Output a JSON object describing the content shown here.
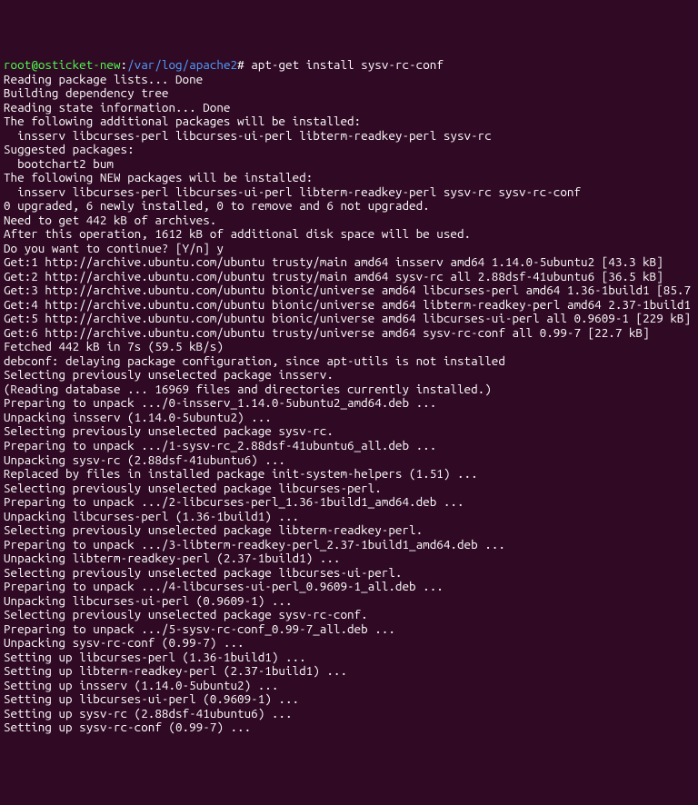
{
  "terminal": {
    "prompt": {
      "user": "root",
      "at": "@",
      "host": "osticket-new",
      "colon": ":",
      "path": "/var/log/apache2",
      "hash": "# "
    },
    "command": "apt-get install sysv-rc-conf",
    "lines": [
      "Reading package lists... Done",
      "Building dependency tree",
      "Reading state information... Done",
      "The following additional packages will be installed:",
      "  insserv libcurses-perl libcurses-ui-perl libterm-readkey-perl sysv-rc",
      "Suggested packages:",
      "  bootchart2 bum",
      "The following NEW packages will be installed:",
      "  insserv libcurses-perl libcurses-ui-perl libterm-readkey-perl sysv-rc sysv-rc-conf",
      "0 upgraded, 6 newly installed, 0 to remove and 6 not upgraded.",
      "Need to get 442 kB of archives.",
      "After this operation, 1612 kB of additional disk space will be used.",
      "Do you want to continue? [Y/n] y",
      "Get:1 http://archive.ubuntu.com/ubuntu trusty/main amd64 insserv amd64 1.14.0-5ubuntu2 [43.3 kB]",
      "Get:2 http://archive.ubuntu.com/ubuntu trusty/main amd64 sysv-rc all 2.88dsf-41ubuntu6 [36.5 kB]",
      "Get:3 http://archive.ubuntu.com/ubuntu bionic/universe amd64 libcurses-perl amd64 1.36-1build1 [85.7",
      "Get:4 http://archive.ubuntu.com/ubuntu bionic/universe amd64 libterm-readkey-perl amd64 2.37-1build1",
      "Get:5 http://archive.ubuntu.com/ubuntu bionic/universe amd64 libcurses-ui-perl all 0.9609-1 [229 kB]",
      "Get:6 http://archive.ubuntu.com/ubuntu trusty/universe amd64 sysv-rc-conf all 0.99-7 [22.7 kB]",
      "Fetched 442 kB in 7s (59.5 kB/s)",
      "debconf: delaying package configuration, since apt-utils is not installed",
      "Selecting previously unselected package insserv.",
      "(Reading database ... 16969 files and directories currently installed.)",
      "Preparing to unpack .../0-insserv_1.14.0-5ubuntu2_amd64.deb ...",
      "Unpacking insserv (1.14.0-5ubuntu2) ...",
      "Selecting previously unselected package sysv-rc.",
      "Preparing to unpack .../1-sysv-rc_2.88dsf-41ubuntu6_all.deb ...",
      "Unpacking sysv-rc (2.88dsf-41ubuntu6) ...",
      "Replaced by files in installed package init-system-helpers (1.51) ...",
      "Selecting previously unselected package libcurses-perl.",
      "Preparing to unpack .../2-libcurses-perl_1.36-1build1_amd64.deb ...",
      "Unpacking libcurses-perl (1.36-1build1) ...",
      "Selecting previously unselected package libterm-readkey-perl.",
      "Preparing to unpack .../3-libterm-readkey-perl_2.37-1build1_amd64.deb ...",
      "Unpacking libterm-readkey-perl (2.37-1build1) ...",
      "Selecting previously unselected package libcurses-ui-perl.",
      "Preparing to unpack .../4-libcurses-ui-perl_0.9609-1_all.deb ...",
      "Unpacking libcurses-ui-perl (0.9609-1) ...",
      "Selecting previously unselected package sysv-rc-conf.",
      "Preparing to unpack .../5-sysv-rc-conf_0.99-7_all.deb ...",
      "Unpacking sysv-rc-conf (0.99-7) ...",
      "Setting up libcurses-perl (1.36-1build1) ...",
      "Setting up libterm-readkey-perl (2.37-1build1) ...",
      "Setting up insserv (1.14.0-5ubuntu2) ...",
      "Setting up libcurses-ui-perl (0.9609-1) ...",
      "Setting up sysv-rc (2.88dsf-41ubuntu6) ...",
      "Setting up sysv-rc-conf (0.99-7) ..."
    ]
  }
}
